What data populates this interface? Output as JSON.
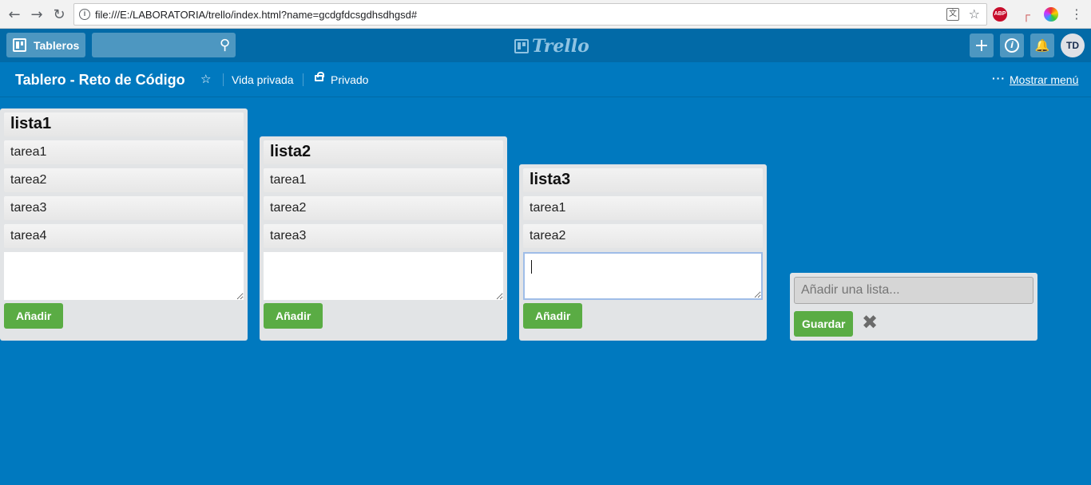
{
  "browser": {
    "url": "file:///E:/LABORATORIA/trello/index.html?name=gcdgfdcsgdhsdhgsd#",
    "ext_abp": "ABP",
    "icons": [
      "back-arrow-icon",
      "forward-arrow-icon",
      "reload-icon",
      "info-icon",
      "translate-icon",
      "bookmark-star-icon",
      "adblock-icon",
      "tool-extension-icon",
      "color-extension-icon",
      "more-vert-icon"
    ]
  },
  "header": {
    "boards_label": "Tableros",
    "logo_text": "Trello",
    "avatar_initials": "TD",
    "colors": {
      "header_bg": "#026aa7",
      "board_bg": "#0079bf",
      "button_bg": "#4d97c1"
    }
  },
  "board": {
    "title": "Tablero - Reto de Código",
    "visibility": "Vida privada",
    "privacy": "Privado",
    "show_menu": "Mostrar menú"
  },
  "lists": [
    {
      "title": "lista1",
      "cards": [
        "tarea1",
        "tarea2",
        "tarea3",
        "tarea4"
      ],
      "add_label": "Añadir"
    },
    {
      "title": "lista2",
      "cards": [
        "tarea1",
        "tarea2",
        "tarea3"
      ],
      "add_label": "Añadir"
    },
    {
      "title": "lista3",
      "cards": [
        "tarea1",
        "tarea2"
      ],
      "add_label": "Añadir"
    }
  ],
  "add_list": {
    "placeholder": "Añadir una lista...",
    "save_label": "Guardar"
  },
  "colors": {
    "add_button": "#5aac44",
    "list_bg": "#e2e4e6"
  }
}
